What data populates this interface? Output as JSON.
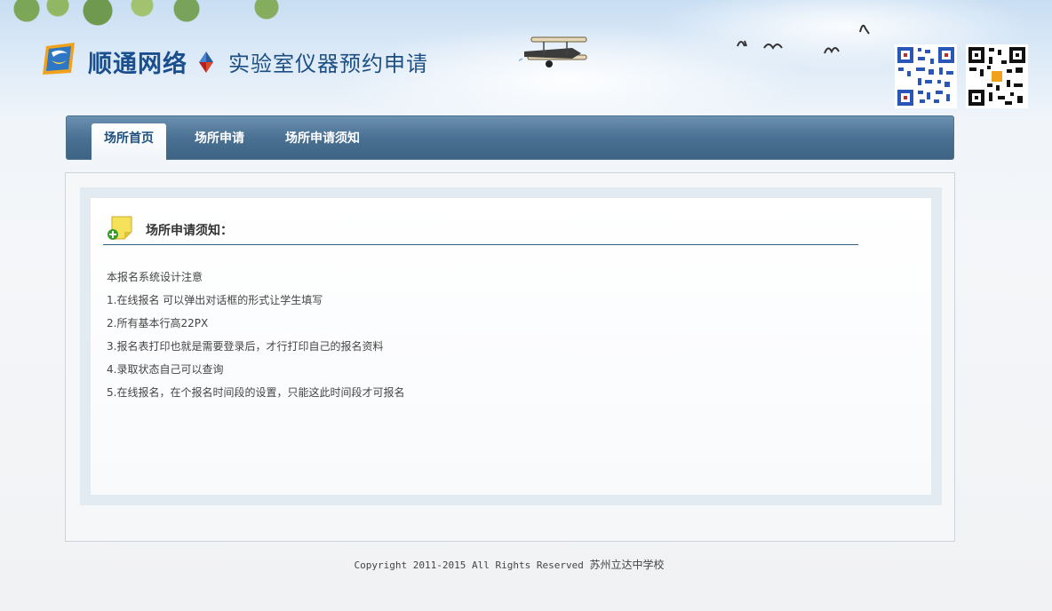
{
  "header": {
    "brand": "顺通网络",
    "system_title": "实验室仪器预约申请",
    "logo_icon": "sun-logo-icon",
    "colors": {
      "brand": "#1a4f8f",
      "sky": "#c8def3"
    }
  },
  "nav": {
    "items": [
      {
        "label": "场所首页",
        "active": true
      },
      {
        "label": "场所申请",
        "active": false
      },
      {
        "label": "场所申请须知",
        "active": false
      }
    ],
    "colors": {
      "bar": "#4a7193",
      "active_text": "#1f4f7f"
    }
  },
  "notice": {
    "title": "场所申请须知：",
    "icon": "sticky-note-add-icon",
    "lines": [
      "本报名系统设计注意",
      "1.在线报名 可以弹出对话框的形式让学生填写",
      "2.所有基本行高22PX",
      "3.报名表打印也就是需要登录后，才行打印自己的报名资料",
      "4.录取状态自己可以查询",
      "5.在线报名，在个报名时间段的设置，只能这此时间段才可报名"
    ]
  },
  "footer": {
    "copyright": "Copyright 2011-2015 All Rights Reserved",
    "school": "苏州立达中学校"
  }
}
